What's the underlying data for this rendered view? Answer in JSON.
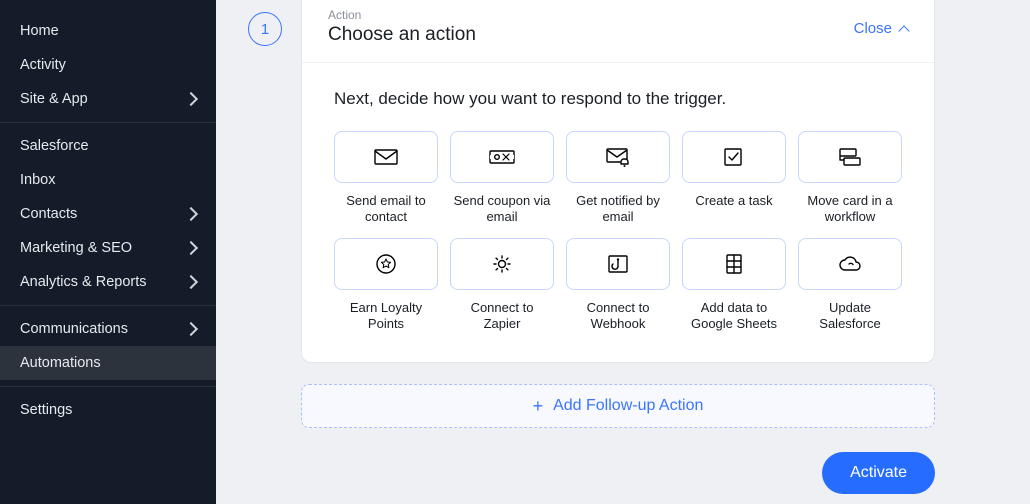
{
  "sidebar": {
    "items": [
      {
        "label": "Home",
        "expandable": false
      },
      {
        "label": "Activity",
        "expandable": false
      },
      {
        "label": "Site & App",
        "expandable": true
      }
    ],
    "items2": [
      {
        "label": "Salesforce",
        "expandable": false
      },
      {
        "label": "Inbox",
        "expandable": false
      },
      {
        "label": "Contacts",
        "expandable": true
      },
      {
        "label": "Marketing & SEO",
        "expandable": true
      },
      {
        "label": "Analytics & Reports",
        "expandable": true
      }
    ],
    "items3": [
      {
        "label": "Communications",
        "expandable": true
      },
      {
        "label": "Automations",
        "expandable": false,
        "active": true
      }
    ],
    "items4": [
      {
        "label": "Settings",
        "expandable": false
      }
    ]
  },
  "step": {
    "number": "1",
    "label": "Action",
    "title": "Choose an action",
    "close": "Close"
  },
  "prompt": "Next, decide how you want to respond to the trigger.",
  "actions": [
    {
      "id": "send-email",
      "label": "Send email to contact",
      "icon": "mail"
    },
    {
      "id": "send-coupon",
      "label": "Send coupon via email",
      "icon": "coupon"
    },
    {
      "id": "get-notified",
      "label": "Get notified by email",
      "icon": "mail-bell"
    },
    {
      "id": "create-task",
      "label": "Create a task",
      "icon": "check-box"
    },
    {
      "id": "move-card",
      "label": "Move card in a workflow",
      "icon": "stack"
    },
    {
      "id": "earn-points",
      "label": "Earn Loyalty Points",
      "icon": "star-circle"
    },
    {
      "id": "zapier",
      "label": "Connect to Zapier",
      "icon": "gear"
    },
    {
      "id": "webhook",
      "label": "Connect to Webhook",
      "icon": "hook"
    },
    {
      "id": "sheets",
      "label": "Add data to Google Sheets",
      "icon": "sheet"
    },
    {
      "id": "salesforce",
      "label": "Update Salesforce",
      "icon": "cloud"
    }
  ],
  "followup": "Add Follow-up Action",
  "activate": "Activate"
}
